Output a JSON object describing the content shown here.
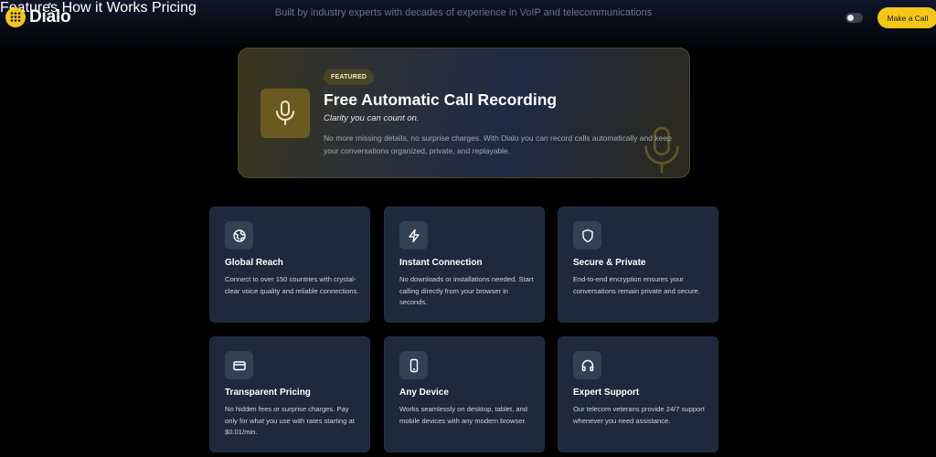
{
  "header": {
    "logo_text": "Dialo",
    "tagline": "Built by industry experts with decades of experience in VoIP and telecommunications",
    "nav": [
      {
        "label": "Features"
      },
      {
        "label": "How it Works"
      },
      {
        "label": "Pricing"
      }
    ],
    "cta_label": "Make a Call",
    "theme_toggle_icon": "toggle-icon"
  },
  "featured": {
    "badge": "FEATURED",
    "title": "Free Automatic Call Recording",
    "subtitle": "Clarity you can count on.",
    "description": "No more missing details, no surprise charges. With Dialo you can record calls automatically and keep your conversations organized, private, and replayable.",
    "icon": "microphone-icon"
  },
  "features": [
    {
      "title": "Global Reach",
      "description": "Connect to over 150 countries with crystal-clear voice quality and reliable connections.",
      "icon": "globe-icon"
    },
    {
      "title": "Instant Connection",
      "description": "No downloads or installations needed. Start calling directly from your browser in seconds.",
      "icon": "lightning-icon"
    },
    {
      "title": "Secure & Private",
      "description": "End-to-end encryption ensures your conversations remain private and secure.",
      "icon": "shield-icon"
    },
    {
      "title": "Transparent Pricing",
      "description": "No hidden fees or surprise charges. Pay only for what you use with rates starting at $0.01/min.",
      "icon": "credit-card-icon"
    },
    {
      "title": "Any Device",
      "description": "Works seamlessly on desktop, tablet, and mobile devices with any modern browser.",
      "icon": "smartphone-icon"
    },
    {
      "title": "Expert Support",
      "description": "Our telecom veterans provide 24/7 support whenever you need assistance.",
      "icon": "headphones-icon"
    }
  ],
  "colors": {
    "accent": "#f5c518",
    "background": "#000000",
    "card": "#1e293b",
    "card_icon_bg": "#334155"
  }
}
